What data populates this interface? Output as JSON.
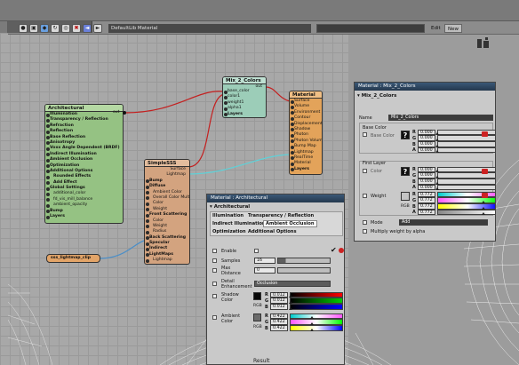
{
  "toolbar": {
    "material_name": "DefaultLib Material",
    "edit_label": "Edit",
    "new_label": "New"
  },
  "nodes": {
    "architectural": {
      "title": "Architectural",
      "out": "out",
      "rows": [
        "Illumination",
        "Transparency / Reflection",
        "Refraction",
        "Reflection",
        "Base Reflection",
        "Anisotropy",
        "Voxx Angle Dependent (BRDF)",
        "Indirect Illumination",
        "Ambient Occlusion",
        "Optimization",
        "Additional Options",
        "Rounded Effects",
        "Add Effect",
        "Global Settings",
        "additional_color",
        "fd_vis_mill_balance",
        "ambient_opacity",
        "Bump",
        "Layers"
      ]
    },
    "simplesss": {
      "title": "SimpleSSS",
      "outs": [
        "Surface",
        "Lightmap"
      ],
      "rows": [
        "Bump",
        "Diffuse",
        "Ambient Color",
        "Overall Color Multip",
        "Color",
        "Weight",
        "Front Scattering",
        "Color",
        "Weight",
        "Radius",
        "Back Scattering",
        "Specular",
        "Indirect",
        "LightMaps",
        "Lightmap"
      ]
    },
    "mix": {
      "title": "Mix_2_Colors",
      "out": "out",
      "rows": [
        "base_color",
        "color1",
        "weight1",
        "alpha1",
        "Layers"
      ]
    },
    "material": {
      "title": "Material",
      "rows": [
        "Surface",
        "Volume",
        "Environment",
        "Contour",
        "Displacement",
        "Shadow",
        "Photon",
        "Photon Volume",
        "Bump Map",
        "Lightmap",
        "RealTime",
        "Material",
        "Layers"
      ]
    },
    "lightmap": {
      "title": "sss_lightmap_clip"
    }
  },
  "arch_panel": {
    "title": "Material : Architectural",
    "section": "Architectural",
    "tabs_row1": [
      "Illumination",
      "Transparency / Reflection"
    ],
    "tabs_row2": [
      "Indirect Illumination",
      "Ambient Occlusion"
    ],
    "tabs_row3": [
      "Optimization",
      "Additional Options"
    ],
    "enable_label": "Enable",
    "samples_label": "Samples",
    "samples_value": "16",
    "max_distance_label": "Max\nDistance",
    "max_distance_value": "0",
    "detail_label": "Detail\nEnhancement",
    "detail_value": "Occlusion",
    "shadow_label": "Shadow\nColor",
    "shadow_rgb": [
      "0.012",
      "0.012",
      "0.012"
    ],
    "ambient_label": "Ambient\nColor",
    "ambient_rgb": [
      "0.422",
      "0.422",
      "0.422"
    ],
    "rgb_label": "RGB",
    "channels": [
      "R",
      "G",
      "B"
    ]
  },
  "mix_panel": {
    "title": "Material : Mix_2_Colors",
    "section": "Mix_2_Colors",
    "name_label": "Name",
    "name_value": "Mix_2_Colors",
    "base_color_section": "Base Color",
    "base_color_label": "Base Color",
    "base_rgba": [
      "0.000",
      "0.000",
      "0.000",
      "0.000"
    ],
    "first_layer_section": "First Layer",
    "color_label": "Color",
    "color_rgba": [
      "0.000",
      "0.000",
      "0.000",
      "0.000"
    ],
    "weight_label": "Weight",
    "weight_rgba": [
      "0.772",
      "0.772",
      "0.772",
      "0.772"
    ],
    "mode_label": "Mode",
    "mode_value": "Add",
    "multiply_label": "Multiply weight by alpha",
    "channels": [
      "R",
      "G",
      "B",
      "A"
    ],
    "rgb_label": "RGB"
  },
  "bottom_label": "Result",
  "colors": {
    "arch_node": "#95c283",
    "sss_node": "#d3a37f",
    "mix_node": "#9ccdb8",
    "material_node": "#e3a35a",
    "clip_node": "#e2a468",
    "wire_red": "#c42020",
    "wire_cyan": "#5fd1d8"
  }
}
